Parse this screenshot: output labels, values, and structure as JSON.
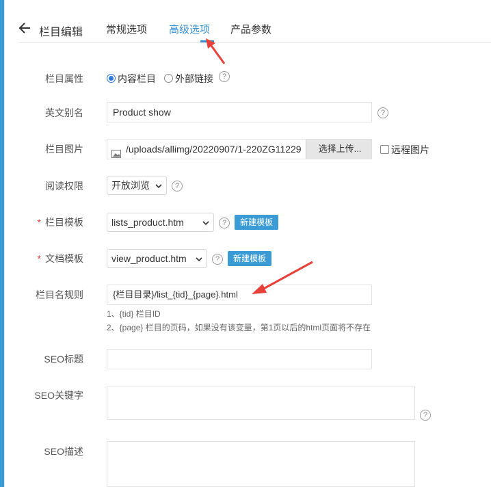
{
  "header": {
    "title": "栏目编辑",
    "tabs": [
      "常规选项",
      "高级选项",
      "产品参数"
    ],
    "active_tab": "高级选项"
  },
  "form": {
    "attr": {
      "label": "栏目属性",
      "options": [
        "内容栏目",
        "外部链接"
      ],
      "selected": "内容栏目",
      "help": "?"
    },
    "english_alias": {
      "label": "英文别名",
      "value": "Product show",
      "help": "?"
    },
    "image": {
      "label": "栏目图片",
      "value": "/uploads/allimg/20220907/1-220ZG11229",
      "upload_button": "选择上传...",
      "remote_label": "远程图片"
    },
    "read_perm": {
      "label": "阅读权限",
      "value": "开放浏览",
      "help": "?"
    },
    "list_tpl": {
      "label": "栏目模板",
      "required": "*",
      "value": "lists_product.htm",
      "new_button": "新建模板",
      "help": "?"
    },
    "doc_tpl": {
      "label": "文档模板",
      "required": "*",
      "value": "view_product.htm",
      "new_button": "新建模板",
      "help": "?"
    },
    "name_rule": {
      "label": "栏目名规则",
      "value": "{栏目目录}/list_{tid}_{page}.html",
      "hint1": "1、{tid} 栏目ID",
      "hint2": "2、{page} 栏目的页码，如果没有该变量，第1页以后的html页面将不存在"
    },
    "seo_title": {
      "label": "SEO标题",
      "value": ""
    },
    "seo_keywords": {
      "label": "SEO关键字",
      "value": "",
      "help": "?"
    },
    "seo_desc": {
      "label": "SEO描述",
      "value": ""
    }
  },
  "colors": {
    "accent": "#3a8fcf",
    "button": "#3a9bd5",
    "annotation": "#e8403a",
    "required": "#e53935"
  }
}
